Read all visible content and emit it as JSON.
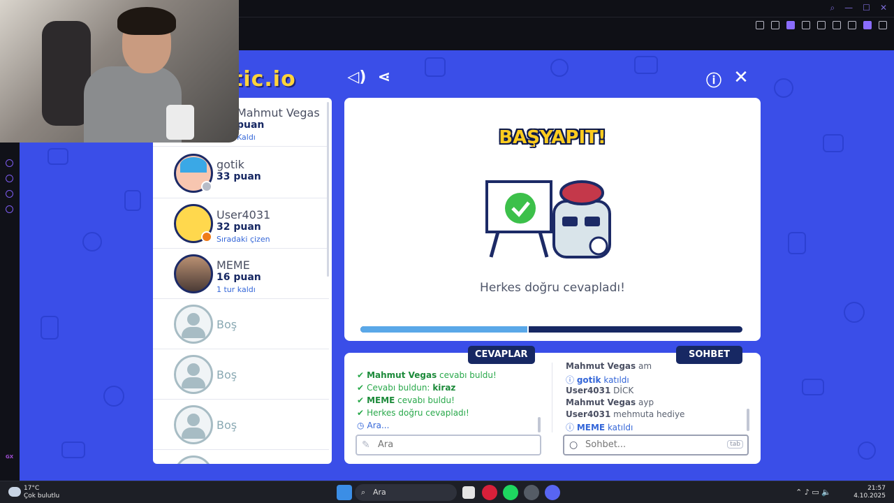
{
  "window": {
    "controls": [
      "⌕",
      "—",
      "☐",
      "✕"
    ]
  },
  "game": {
    "logo": "tic.io",
    "masterpiece": "BAŞYAPIT!",
    "everyone_correct": "Herkes doğru cevapladı!",
    "round_progress": 0.44,
    "players": [
      {
        "name": "Mahmut Vegas",
        "score": "puan",
        "note": "Kaldı"
      },
      {
        "name": "gotik",
        "score": "33 puan",
        "note": ""
      },
      {
        "name": "User4031",
        "score": "32 puan",
        "note": "Sıradaki çizen"
      },
      {
        "name": "MEME",
        "score": "16 puan",
        "note": "1 tur kaldı"
      },
      {
        "name": "Boş"
      },
      {
        "name": "Boş"
      },
      {
        "name": "Boş"
      }
    ],
    "answers_tab": "CEVAPLAR",
    "chat_tab": "SOHBET",
    "answers": [
      {
        "user": "Mahmut Vegas",
        "text": "cevabı buldu!"
      },
      {
        "user": "",
        "text": "Cevabı buldun:",
        "word": "kiraz"
      },
      {
        "user": "MEME",
        "text": "cevabı buldu!"
      },
      {
        "user": "",
        "text": "Herkes doğru cevapladı!"
      },
      {
        "user": "",
        "text": "Ara..."
      }
    ],
    "chat": [
      {
        "user": "Mahmut Vegas",
        "text": "am"
      },
      {
        "user": "gotik",
        "text": "katıldı",
        "join": true
      },
      {
        "user": "User4031",
        "text": "DİCK"
      },
      {
        "user": "Mahmut Vegas",
        "text": "ayp"
      },
      {
        "user": "User4031",
        "text": "mehmuta hediye"
      },
      {
        "user": "MEME",
        "text": "katıldı",
        "join": true
      }
    ],
    "answer_placeholder": "Ara",
    "chat_placeholder": "Sohbet...",
    "chat_key_hint": "tab"
  },
  "taskbar": {
    "temp": "17°C",
    "weather": "Çok bulutlu",
    "search": "Ara",
    "time": "21:57",
    "date": "4.10.2025"
  },
  "colors": {
    "game_bg": "#3a4ee8",
    "accent": "#172863",
    "gold": "#ffcc1f"
  }
}
